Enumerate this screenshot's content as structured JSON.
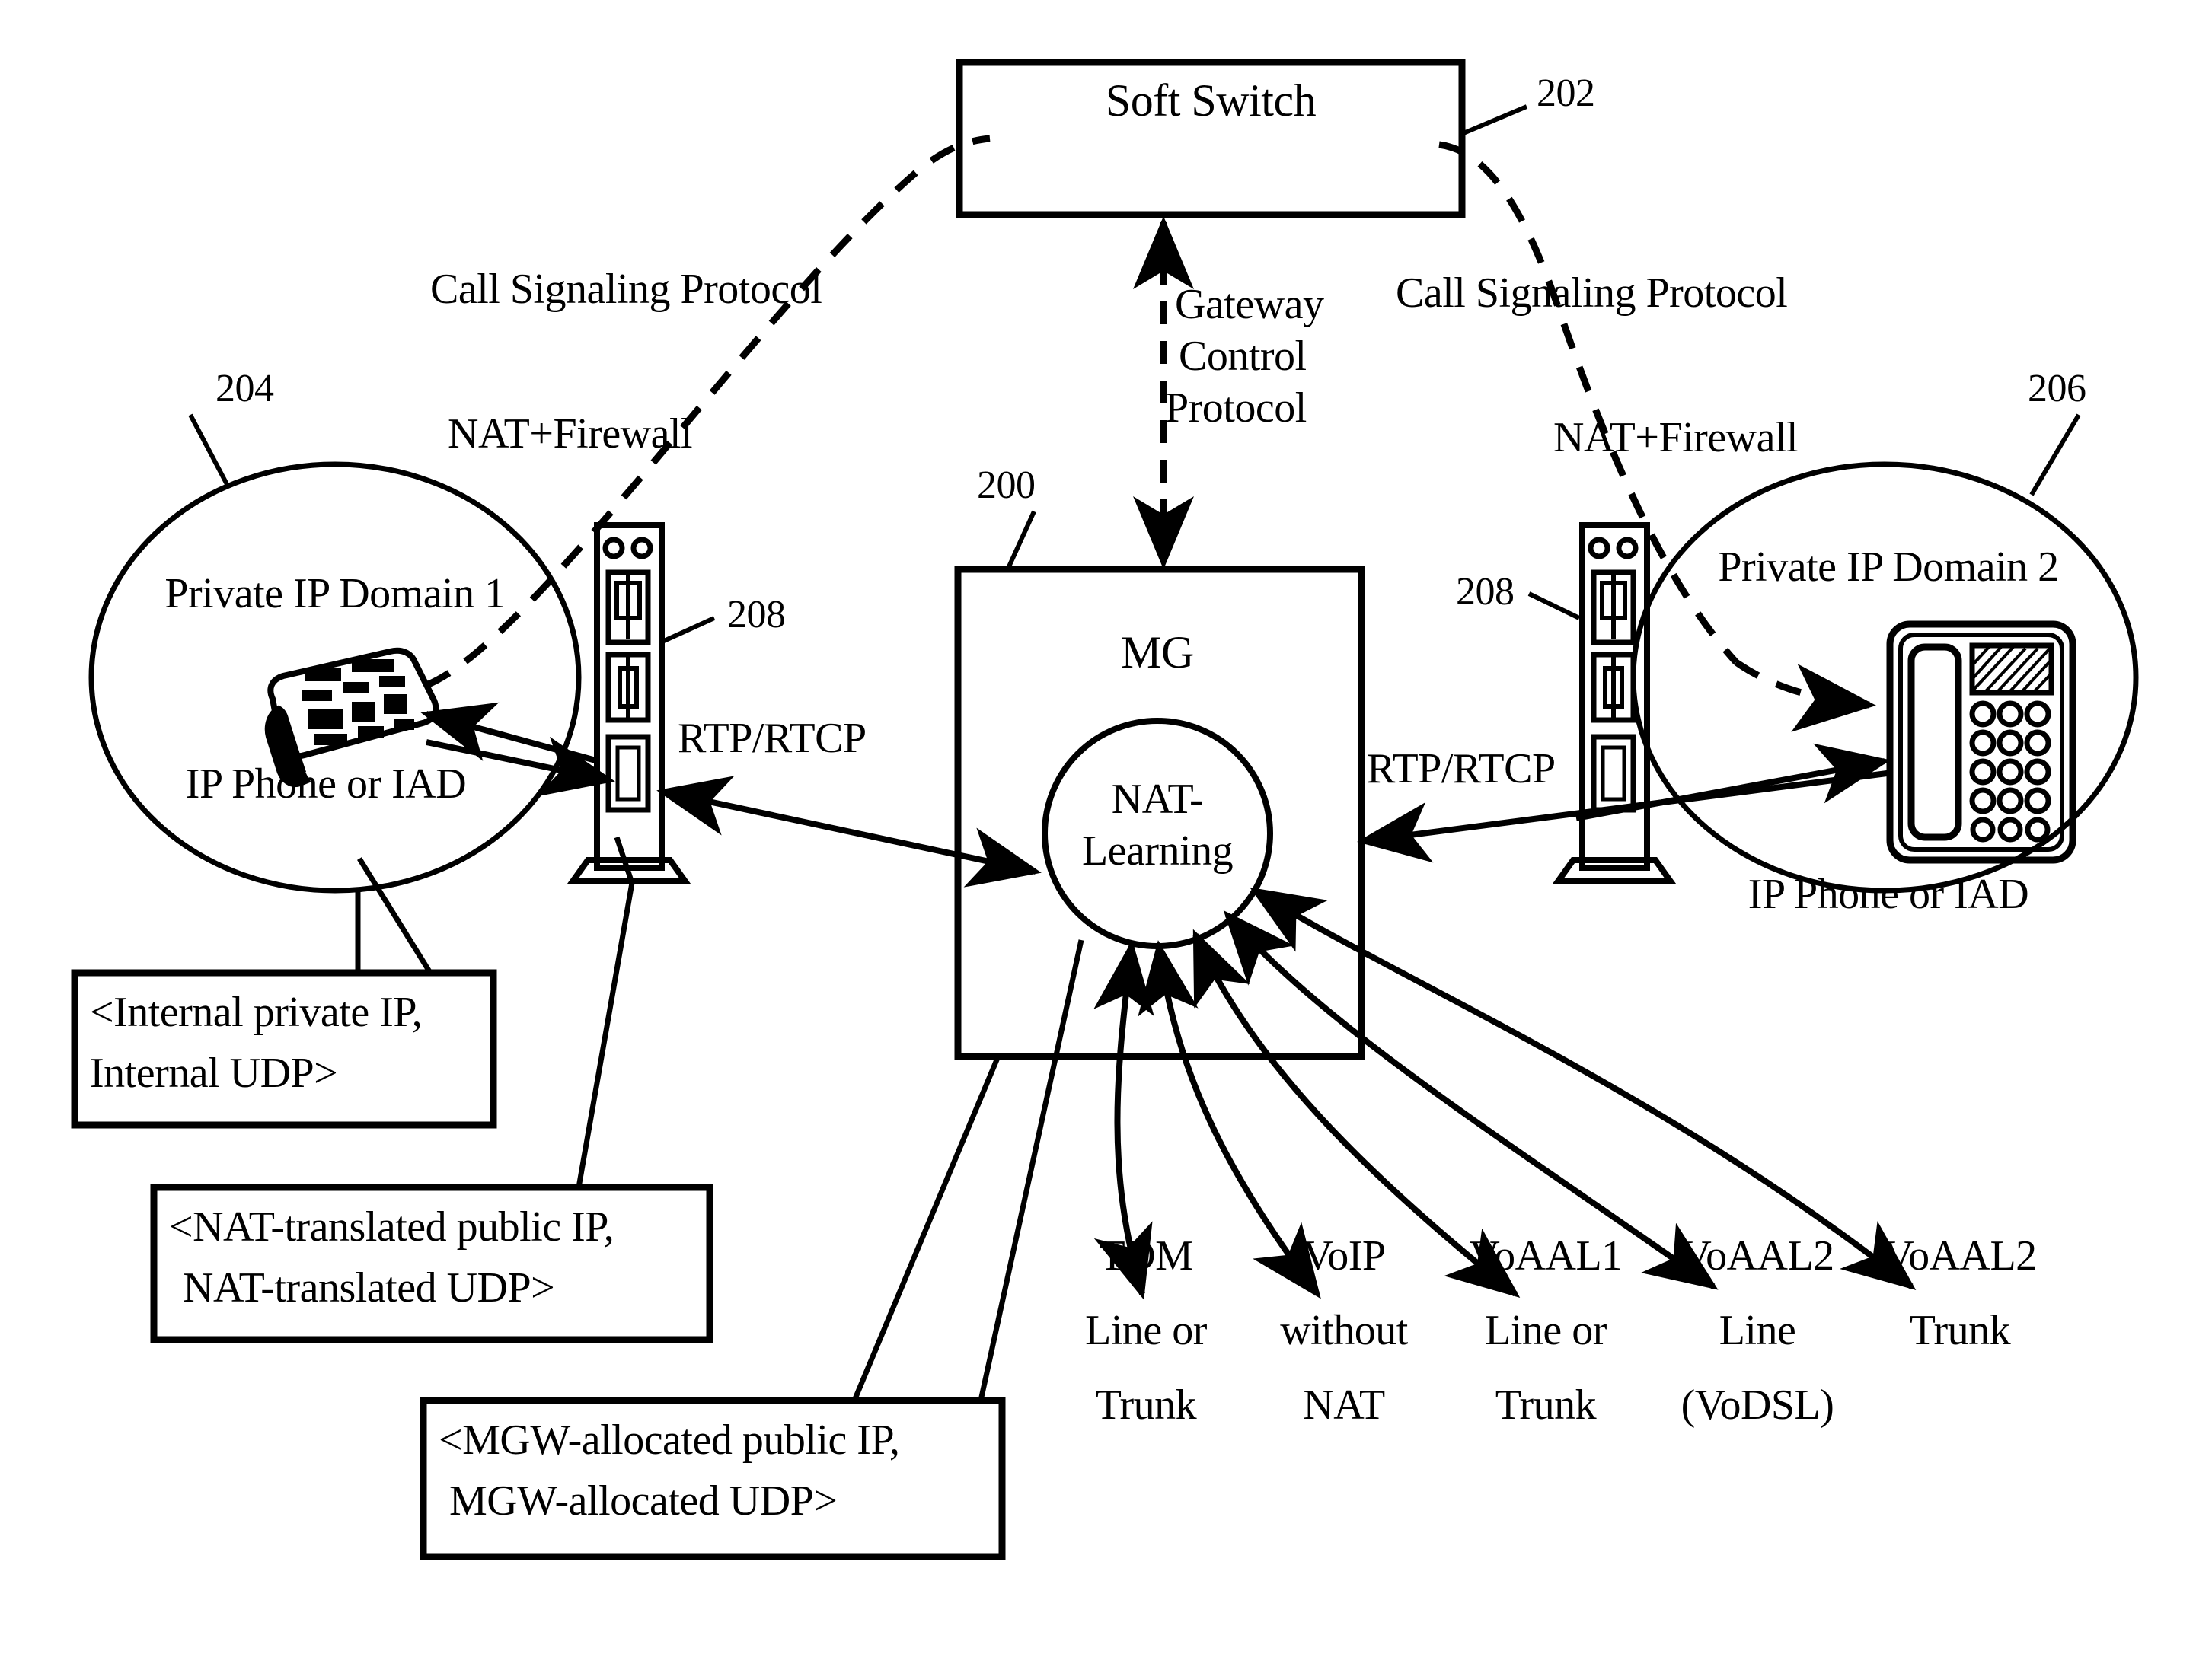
{
  "figure": {
    "domain": "patent-network-diagram",
    "ink_color": "#000000",
    "background_color": "#ffffff"
  },
  "nodes": {
    "soft_switch": {
      "label": "Soft Switch",
      "ref": "202"
    },
    "media_gateway": {
      "label": "MG",
      "ref": "200"
    },
    "nat_learning": {
      "line1": "NAT-",
      "line2": "Learning"
    },
    "domain_left": {
      "ref": "204",
      "label": "Private IP Domain 1",
      "endpoint": "IP Phone or IAD"
    },
    "domain_right": {
      "ref": "206",
      "label": "Private IP Domain 2",
      "endpoint": "IP Phone or IAD"
    },
    "firewall_left": {
      "ref": "208",
      "label": "NAT+Firewall"
    },
    "firewall_right": {
      "ref": "208",
      "label": "NAT+Firewall"
    }
  },
  "links": {
    "call_signaling_left": "Call Signaling Protocol",
    "call_signaling_right": "Call Signaling Protocol",
    "gateway_control": {
      "line1": "Gateway",
      "line2": "Control",
      "line3": "Protocol"
    },
    "rtp_rtcp_left": "RTP/RTCP",
    "rtp_rtcp_right": "RTP/RTCP"
  },
  "callouts": [
    {
      "line1": "<Internal private IP,",
      "line2": "Internal UDP>"
    },
    {
      "line1": "<NAT-translated public IP,",
      "line2": "NAT-translated UDP>"
    },
    {
      "line1": "<MGW-allocated public IP,",
      "line2": "MGW-allocated UDP>"
    }
  ],
  "interfaces": [
    {
      "line1": "TDM",
      "line2": "Line or",
      "line3": "Trunk"
    },
    {
      "line1": "VoIP",
      "line2": "without",
      "line3": "NAT"
    },
    {
      "line1": "VoAAL1",
      "line2": "Line or",
      "line3": "Trunk"
    },
    {
      "line1": "VoAAL2",
      "line2": "Line",
      "line3": "(VoDSL)"
    },
    {
      "line1": "VoAAL2",
      "line2": "Trunk",
      "line3": ""
    }
  ]
}
